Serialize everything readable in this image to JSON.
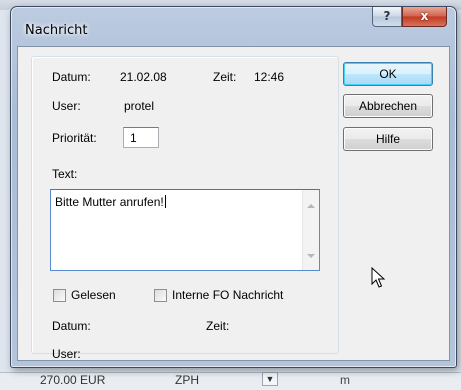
{
  "dialog": {
    "title": "Nachricht",
    "help_button": "?",
    "close_button": "x"
  },
  "fields": {
    "datum_label": "Datum:",
    "datum_value": "21.02.08",
    "zeit_label": "Zeit:",
    "zeit_value": "12:46",
    "user_label": "User:",
    "user_value": "protel",
    "prioritaet_label": "Priorität:",
    "prioritaet_value": "1",
    "text_label": "Text:",
    "text_value": "Bitte Mutter anrufen!"
  },
  "checkboxes": {
    "gelesen": {
      "label": "Gelesen",
      "checked": false
    },
    "interne": {
      "label": "Interne FO Nachricht",
      "checked": false
    }
  },
  "footer": {
    "datum_label": "Datum:",
    "zeit_label": "Zeit:",
    "user_label": "User:"
  },
  "buttons": {
    "ok": "OK",
    "abbrechen": "Abbrechen",
    "hilfe": "Hilfe"
  },
  "background": {
    "bottom_left_text": "270.00 EUR",
    "bottom_mid_text": "ZPH",
    "bottom_right_text": "m"
  }
}
